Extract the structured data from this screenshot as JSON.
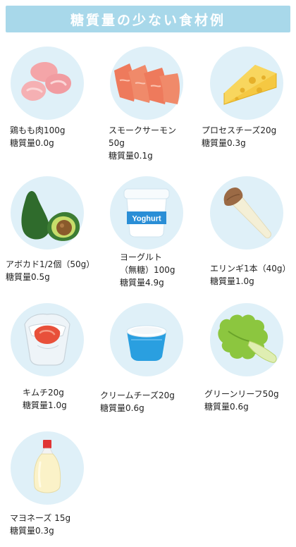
{
  "header": {
    "title": "糖質量の少ない食材例"
  },
  "items": [
    {
      "name": "鶏もも肉100g",
      "carb": "糖質量0.0g",
      "icon": "chicken-thigh-icon"
    },
    {
      "name": "スモークサーモン",
      "name2": "50g",
      "carb": "糖質量0.1g",
      "icon": "smoked-salmon-icon"
    },
    {
      "name": "プロセスチーズ20g",
      "carb": "糖質量0.3g",
      "icon": "cheese-icon"
    },
    {
      "name": "アボカド1/2個（50g）",
      "carb": "糖質量0.5g",
      "icon": "avocado-icon"
    },
    {
      "name": "ヨーグルト",
      "name2": "（無糖）100g",
      "carb": "糖質量4.9g",
      "icon": "yogurt-icon",
      "tub_label": "Yoghurt"
    },
    {
      "name": "エリンギ1本（40g）",
      "carb": "糖質量1.0g",
      "icon": "eringi-mushroom-icon"
    },
    {
      "name": "キムチ20g",
      "carb": "糖質量1.0g",
      "icon": "kimchi-icon"
    },
    {
      "name": "クリームチーズ20g",
      "carb": "糖質量0.6g",
      "icon": "cream-cheese-icon"
    },
    {
      "name": "グリーンリーフ50g",
      "carb": "糖質量0.6g",
      "icon": "green-leaf-lettuce-icon"
    },
    {
      "name": "マヨネーズ 15g",
      "carb": "糖質量0.3g",
      "icon": "mayonnaise-icon"
    }
  ],
  "colors": {
    "banner": "#a8d8ea",
    "circle": "#dff0f8"
  }
}
